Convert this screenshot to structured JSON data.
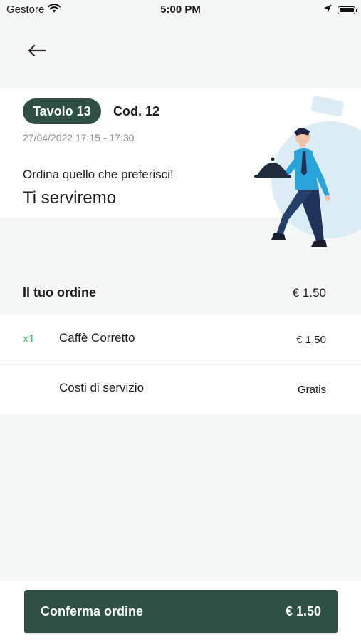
{
  "status_bar": {
    "carrier": "Gestore",
    "time": "5:00 PM",
    "icons": [
      "wifi-icon",
      "location-arrow-icon",
      "battery-icon"
    ]
  },
  "nav": {
    "back_icon": "arrow-left-icon"
  },
  "header": {
    "table_label": "Tavolo 13",
    "code_label": "Cod. 12",
    "datetime": "27/04/2022 17:15 - 17:30",
    "subtitle": "Ordina quello che preferisci!",
    "title": "Ti serviremo"
  },
  "order": {
    "title": "Il tuo ordine",
    "total": "€ 1.50",
    "items": [
      {
        "qty": "x1",
        "name": "Caffè Corretto",
        "price": "€ 1.50"
      },
      {
        "qty": "",
        "name": "Costi di servizio",
        "price": "Gratis"
      }
    ]
  },
  "footer": {
    "confirm_label": "Conferma ordine",
    "confirm_price": "€ 1.50"
  },
  "colors": {
    "primary": "#2e4f43",
    "accent_green": "#3cc47c",
    "background": "#f5f7f6",
    "illustration_shirt": "#2aa3db",
    "illustration_circle": "#dcecf4"
  }
}
